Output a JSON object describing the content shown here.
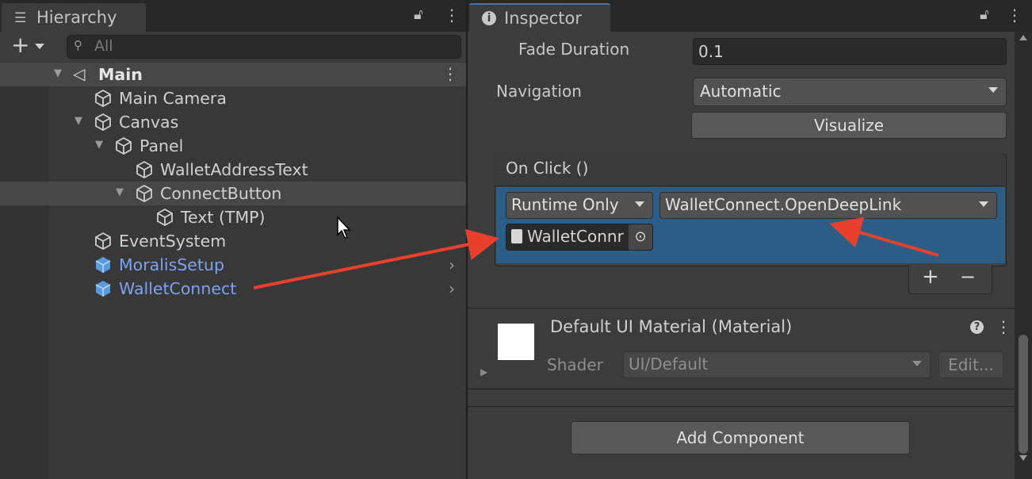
{
  "hierarchy": {
    "tab_label": "Hierarchy",
    "search_placeholder": "All",
    "scene_name": "Main",
    "items": [
      {
        "label": "Main Camera"
      },
      {
        "label": "Canvas"
      },
      {
        "label": "Panel"
      },
      {
        "label": "WalletAddressText"
      },
      {
        "label": "ConnectButton"
      },
      {
        "label": "Text (TMP)"
      },
      {
        "label": "EventSystem"
      },
      {
        "label": "MoralisSetup"
      },
      {
        "label": "WalletConnect"
      }
    ]
  },
  "inspector": {
    "tab_label": "Inspector",
    "fade_duration_label": "Fade Duration",
    "fade_duration_value": "0.1",
    "navigation_label": "Navigation",
    "navigation_value": "Automatic",
    "visualize_label": "Visualize",
    "onclick": {
      "header": "On Click ()",
      "mode": "Runtime Only",
      "function": "WalletConnect.OpenDeepLink",
      "target_object": "WalletConnr"
    },
    "add_label": "+",
    "remove_label": "−",
    "material": {
      "title": "Default UI Material (Material)",
      "shader_label": "Shader",
      "shader_value": "UI/Default",
      "edit_label": "Edit..."
    },
    "add_component_label": "Add Component"
  },
  "colors": {
    "selection_blue": "#2c5d87",
    "prefab_blue": "#7ba3f0",
    "annotation_red": "#e8402c"
  }
}
